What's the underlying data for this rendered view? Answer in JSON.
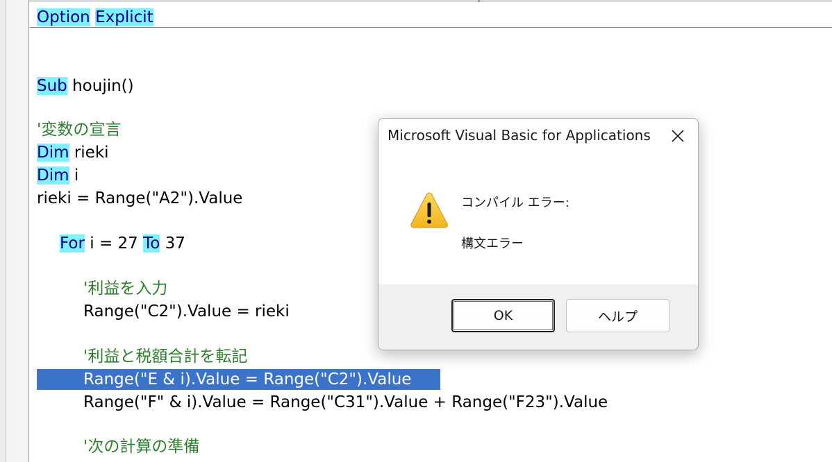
{
  "editor": {
    "header_line": {
      "kw1": "Option",
      "space": " ",
      "kw2": "Explicit"
    },
    "lines": {
      "sub": {
        "kw": "Sub",
        "rest": " houjin()"
      },
      "comment_vars": "'変数の宣言",
      "dim1": {
        "kw": "Dim",
        "rest": " rieki"
      },
      "dim2": {
        "kw": "Dim",
        "rest": " i"
      },
      "assign": "rieki = Range(\"A2\").Value",
      "for": {
        "kw1": "For",
        "mid": " i = 27 ",
        "kw2": "To",
        "rest": " 37"
      },
      "comment_input": "'利益を入力",
      "range_c2": "Range(\"C2\").Value = rieki",
      "comment_transfer": "'利益と税額合計を転記",
      "selected": "Range(\"E & i).Value = Range(\"C2\").Value",
      "range_f": "Range(\"F\" & i).Value = Range(\"C31\").Value + Range(\"F23\").Value",
      "comment_next": "'次の計算の準備"
    }
  },
  "dialog": {
    "title": "Microsoft Visual Basic for Applications",
    "icon": "warning-icon",
    "heading": "コンパイル エラー:",
    "message": "構文エラー",
    "ok_label": "OK",
    "help_label": "ヘルプ"
  },
  "colors": {
    "keyword_highlight": "#7ff0ff",
    "keyword_text": "#00008b",
    "comment_text": "#2f7d2f",
    "selection": "#3b73c8",
    "warning_yellow": "#f5c430"
  }
}
